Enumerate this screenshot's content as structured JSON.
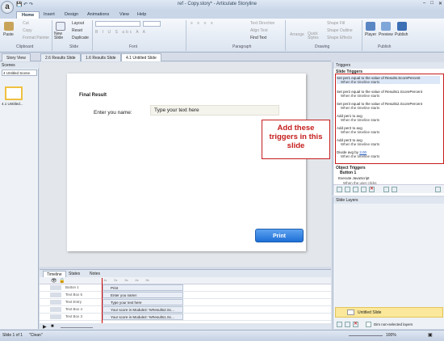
{
  "window": {
    "title": "ref - Copy.story* - Articulate Storyline",
    "orb": "a"
  },
  "menu_tabs": [
    "Home",
    "Insert",
    "Design",
    "Animations",
    "View",
    "Help"
  ],
  "ribbon": {
    "clipboard": {
      "paste": "Paste",
      "cut": "Cut",
      "copy": "Copy",
      "format_painter": "Format Painter",
      "label": "Clipboard"
    },
    "slide": {
      "new_slide": "New Slide",
      "layout": "Layout",
      "reset": "Reset",
      "duplicate": "Duplicate",
      "label": "Slide"
    },
    "font": {
      "label": "Font"
    },
    "paragraph": {
      "text_direction": "Text Direction",
      "align_text": "Align Text",
      "find_text": "Find Text",
      "label": "Paragraph"
    },
    "drawing": {
      "arrange": "Arrange",
      "quick_styles": "Quick Styles",
      "shape_fill": "Shape Fill",
      "shape_outline": "Shape Outline",
      "shape_effects": "Shape Effects",
      "label": "Drawing"
    },
    "publish": {
      "player": "Player",
      "preview": "Preview",
      "publish": "Publish",
      "label": "Publish"
    }
  },
  "doc_tabs": [
    "Story View",
    "2.6 Results Slide",
    "1.6 Results Slide",
    "4.1 Untitled Slide"
  ],
  "scenes": {
    "header": "Scenes",
    "selected_scene": "4 Untitled Scene",
    "thumb_label": "4.1 Untitled..."
  },
  "slide": {
    "title": "Final Result",
    "name_label": "Enter you name:",
    "input_placeholder": "Type your text here",
    "print_button": "Print"
  },
  "timeline": {
    "tabs": [
      "Timeline",
      "States",
      "Notes"
    ],
    "rows": [
      {
        "name": "Button 1",
        "bar": "Print"
      },
      {
        "name": "Text Box 5",
        "bar": "Enter you name:"
      },
      {
        "name": "Text Entry",
        "bar": "Type your text here"
      },
      {
        "name": "Text Box 4",
        "bar": "Your score in Module3: %Results2.Sc..."
      },
      {
        "name": "Text Box 3",
        "bar": "Your score in Module2: %Results1.Sc..."
      }
    ]
  },
  "triggers": {
    "header": "Triggers",
    "slide_triggers": "Slide Triggers",
    "items": [
      {
        "action": "Set per1 equal to the value of Results.ScorePercent",
        "when": "When the timeline starts"
      },
      {
        "action": "Set per2 equal to the value of Results1.ScorePercent",
        "when": "When the timeline starts"
      },
      {
        "action": "Set per3 equal to the value of Results2.ScorePercent",
        "when": "When the timeline starts"
      },
      {
        "action": "Add per1 to avg",
        "when": "When the timeline starts"
      },
      {
        "action": "Add per2 to avg",
        "when": "When the timeline starts"
      },
      {
        "action": "Add per3 to avg",
        "when": "When the timeline starts"
      },
      {
        "action": "Divide avg by ",
        "link": "3.00",
        "when": "When the timeline starts"
      }
    ],
    "object_triggers": "Object Triggers",
    "button_label": "Button 1",
    "exec_action": "Execute JavaScript",
    "exec_when": "When the user clicks"
  },
  "layers": {
    "header": "Slide Layers",
    "base_layer": "Untitled Slide",
    "dim_label": "Dim non-selected layers"
  },
  "callout": "Add these triggers in this slide",
  "status": {
    "slide_info": "Slide 1 of 1",
    "theme": "\"Clean\"",
    "zoom": "100%"
  },
  "colors": {
    "accent_red": "#c51c1c",
    "print_blue": "#1e6fd6",
    "layer_yellow": "#fbe89a"
  }
}
